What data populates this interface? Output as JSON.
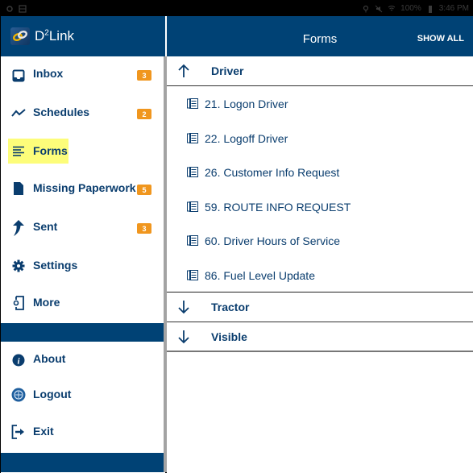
{
  "status_bar": {
    "battery": "100%",
    "time": "3:46 PM",
    "left_icons": [
      "sync-icon",
      "screenshot-icon"
    ],
    "right_icons": [
      "location-icon",
      "mute-icon",
      "wifi-icon",
      "battery-icon"
    ]
  },
  "app": {
    "name_prefix": "D",
    "name_sup": "2",
    "name_suffix": "Link"
  },
  "drawer": {
    "items": [
      {
        "label": "Inbox",
        "icon": "inbox-icon",
        "badge": "3"
      },
      {
        "label": "Schedules",
        "icon": "trend-icon",
        "badge": "2"
      },
      {
        "label": "Forms",
        "icon": "lines-icon",
        "badge": null,
        "selected": true
      },
      {
        "label": "Missing Paperwork",
        "icon": "document-icon",
        "badge": "5"
      },
      {
        "label": "Sent",
        "icon": "send-arrow-icon",
        "badge": "3"
      },
      {
        "label": "Settings",
        "icon": "gear-icon",
        "badge": null
      },
      {
        "label": "More",
        "icon": "device-settings-icon",
        "badge": null
      }
    ],
    "footer_items": [
      {
        "label": "About",
        "icon": "info-icon"
      },
      {
        "label": "Logout",
        "icon": "logout-globe-icon"
      },
      {
        "label": "Exit",
        "icon": "exit-icon"
      }
    ]
  },
  "main": {
    "title": "Forms",
    "show_all_label": "SHOW ALL",
    "groups": [
      {
        "label": "Driver",
        "expanded": true,
        "forms": [
          "21. Logon Driver",
          "22. Logoff Driver",
          "26. Customer Info Request",
          "59. ROUTE INFO REQUEST",
          "60. Driver Hours of Service",
          "86. Fuel Level Update"
        ]
      },
      {
        "label": "Tractor",
        "expanded": false,
        "forms": []
      },
      {
        "label": "Visible",
        "expanded": false,
        "forms": []
      }
    ]
  },
  "colors": {
    "primary": "#004275",
    "text": "#0a3d6e",
    "badge": "#f0961e",
    "highlight": "#fdfd7a"
  }
}
